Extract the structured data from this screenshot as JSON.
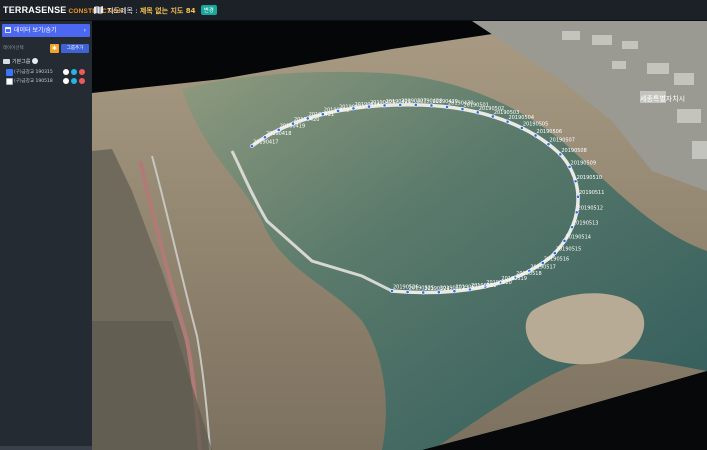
{
  "brand": {
    "name": "TERRASENSE",
    "sub": "CONSTRUCTION"
  },
  "header": {
    "map_title_label": "지도제목 :",
    "map_title_value": "제목 없는 지도 84",
    "change_label": "변경"
  },
  "sidebar": {
    "data_view_label": "데이터 보기/숨기",
    "chevron": "›",
    "layer_select_label": "레이어선택",
    "group_add_label": "그룹추가",
    "group": {
      "name": "기본그룹"
    },
    "layers": [
      {
        "label": "(구)금강교 190315",
        "checked": true
      },
      {
        "label": "(구)금강교 190518",
        "checked": false
      }
    ]
  },
  "map": {
    "place_label": "세종특별자치시",
    "ring_labels": [
      "20190417",
      "20190418",
      "20190419",
      "20190420",
      "20190421",
      "20190422",
      "20190423",
      "20190424",
      "20190425",
      "20190426",
      "20190427",
      "20190428",
      "20190429",
      "20190430",
      "20190501",
      "20190502",
      "20190503",
      "20190504",
      "20190505",
      "20190506",
      "20190507",
      "20190508",
      "20190509",
      "20190510",
      "20190511",
      "20190512",
      "20190513",
      "20190514",
      "20190515",
      "20190516",
      "20190517",
      "20190518",
      "20190519",
      "20190520",
      "20190521",
      "20190522",
      "20190523",
      "20190524",
      "20190525",
      "20190526"
    ]
  },
  "colors": {
    "accent_blue": "#4c67f0",
    "brand_orange": "#f59a23",
    "teal": "#18a79a",
    "title_yellow": "#f5c451"
  },
  "icons": {
    "map": "map-icon",
    "view": "eye-icon",
    "folder": "folder-icon",
    "check": "check-circle-icon"
  }
}
